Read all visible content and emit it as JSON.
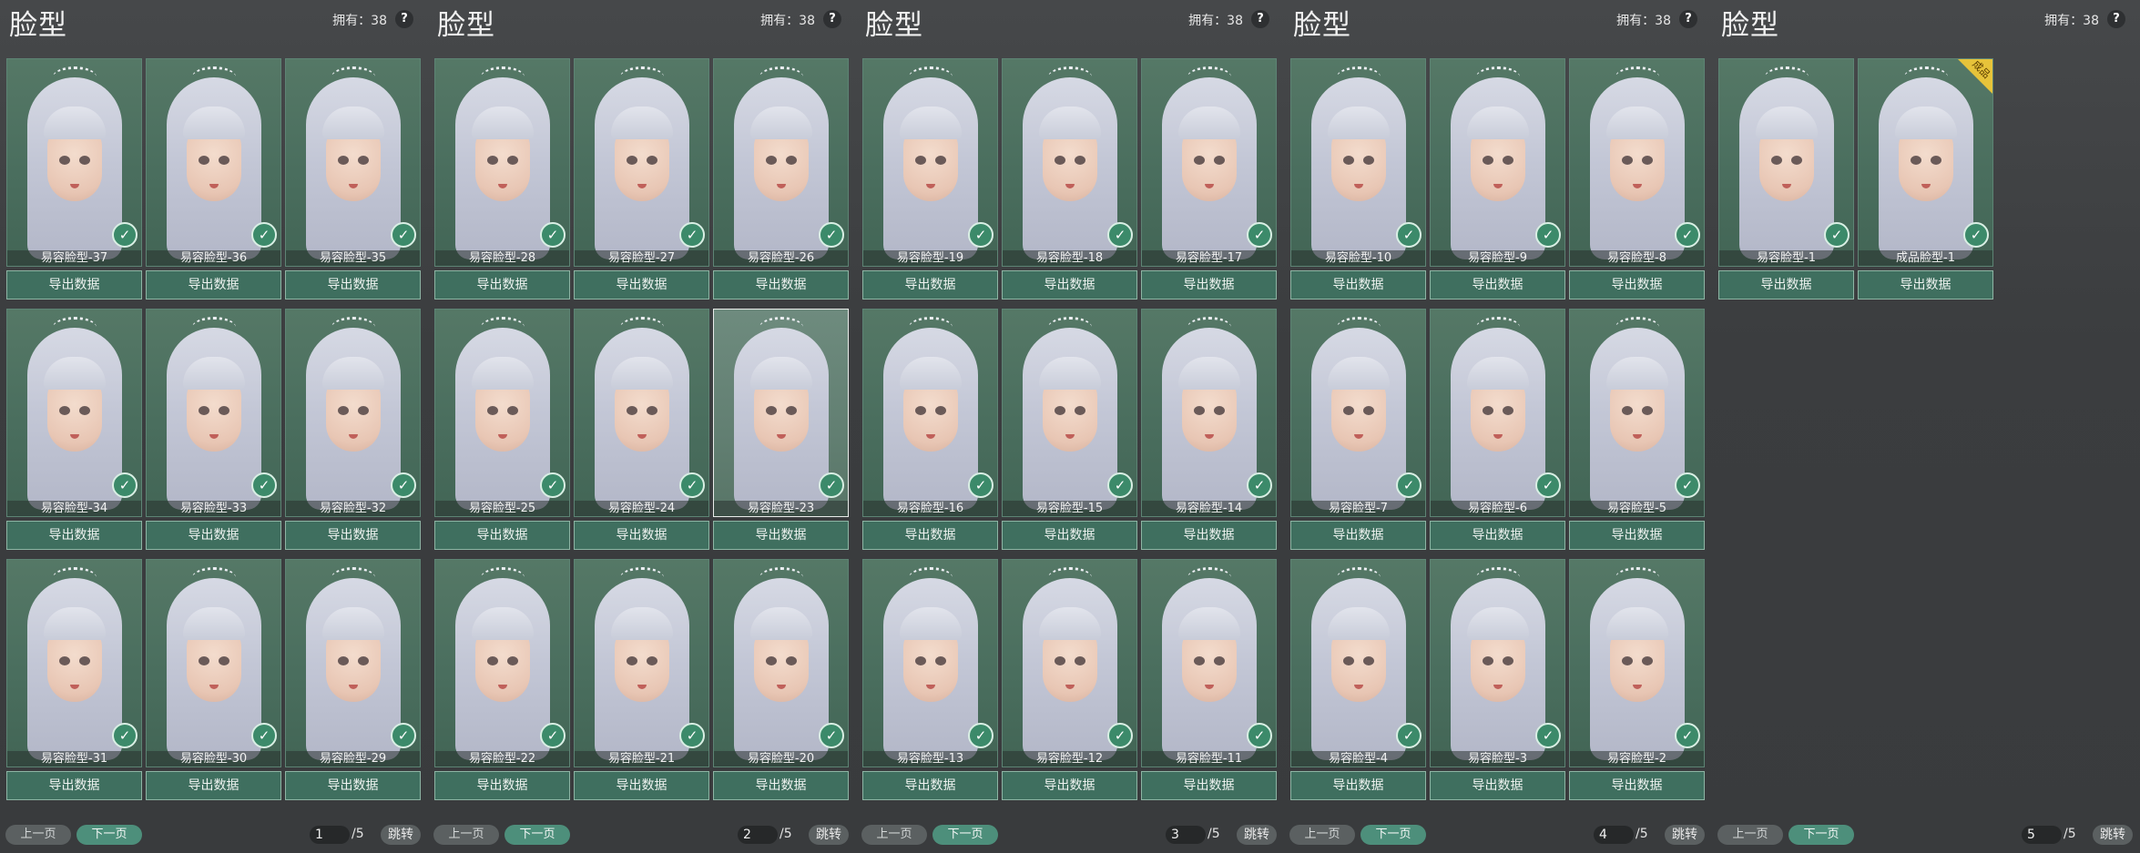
{
  "panels": [
    {
      "title": "脸型",
      "owned": "拥有：38",
      "help": "?",
      "cards": [
        "易容脸型-37",
        "易容脸型-36",
        "易容脸型-35",
        "易容脸型-34",
        "易容脸型-33",
        "易容脸型-32",
        "易容脸型-31",
        "易容脸型-30",
        "易容脸型-29"
      ],
      "selected": -1,
      "page": "1",
      "total": "/5",
      "prev": "上一页",
      "next": "下一页",
      "jump": "跳转"
    },
    {
      "title": "脸型",
      "owned": "拥有：38",
      "help": "?",
      "cards": [
        "易容脸型-28",
        "易容脸型-27",
        "易容脸型-26",
        "易容脸型-25",
        "易容脸型-24",
        "易容脸型-23",
        "易容脸型-22",
        "易容脸型-21",
        "易容脸型-20"
      ],
      "selected": 5,
      "page": "2",
      "total": "/5",
      "prev": "上一页",
      "next": "下一页",
      "jump": "跳转"
    },
    {
      "title": "脸型",
      "owned": "拥有：38",
      "help": "?",
      "cards": [
        "易容脸型-19",
        "易容脸型-18",
        "易容脸型-17",
        "易容脸型-16",
        "易容脸型-15",
        "易容脸型-14",
        "易容脸型-13",
        "易容脸型-12",
        "易容脸型-11"
      ],
      "selected": -1,
      "page": "3",
      "total": "/5",
      "prev": "上一页",
      "next": "下一页",
      "jump": "跳转"
    },
    {
      "title": "脸型",
      "owned": "拥有：38",
      "help": "?",
      "cards": [
        "易容脸型-10",
        "易容脸型-9",
        "易容脸型-8",
        "易容脸型-7",
        "易容脸型-6",
        "易容脸型-5",
        "易容脸型-4",
        "易容脸型-3",
        "易容脸型-2"
      ],
      "selected": -1,
      "page": "4",
      "total": "/5",
      "prev": "上一页",
      "next": "下一页",
      "jump": "跳转"
    },
    {
      "title": "脸型",
      "owned": "拥有：38",
      "help": "?",
      "cards": [
        "易容脸型-1",
        "成品脸型-1"
      ],
      "selected": -1,
      "page": "5",
      "total": "/5",
      "prev": "上一页",
      "next": "下一页",
      "jump": "跳转"
    }
  ],
  "export_label": "导出数据",
  "badge_label": "成品",
  "icons": {
    "equipped": "check-icon",
    "help": "help-icon"
  },
  "colors": {
    "accent": "#4d8f7b",
    "card_bg": "#4a6e5e",
    "export_bg": "#3f6f5f",
    "badge": "#e7c33a"
  }
}
